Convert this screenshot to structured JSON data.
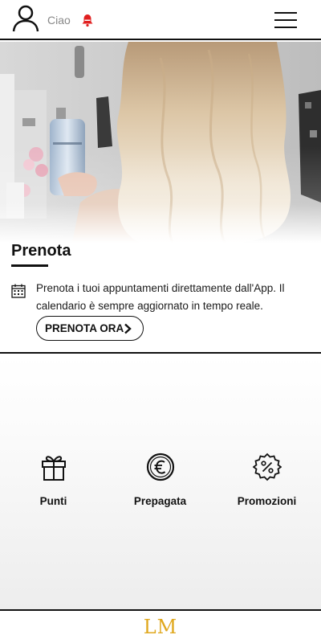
{
  "header": {
    "greeting": "Ciao",
    "user_icon": "user-icon",
    "notification_icon": "bell-icon",
    "notification_color": "#e02020",
    "menu_icon": "hamburger-menu-icon"
  },
  "hero": {
    "image": "salon-blonde-hair-photo"
  },
  "booking_card": {
    "title": "Prenota",
    "icon": "calendar-icon",
    "description": "Prenota i tuoi appuntamenti direttamente dall'App. Il calendario è sempre aggiornato in tempo reale.",
    "button_label": "PRENOTA ORA",
    "button_icon": "chevron-right-icon"
  },
  "features": [
    {
      "label": "Punti",
      "icon": "gift-icon"
    },
    {
      "label": "Prepagata",
      "icon": "euro-coin-icon"
    },
    {
      "label": "Promozioni",
      "icon": "discount-badge-icon"
    }
  ],
  "footer": {
    "logo": "LM",
    "logo_color": "#e0a81e"
  }
}
